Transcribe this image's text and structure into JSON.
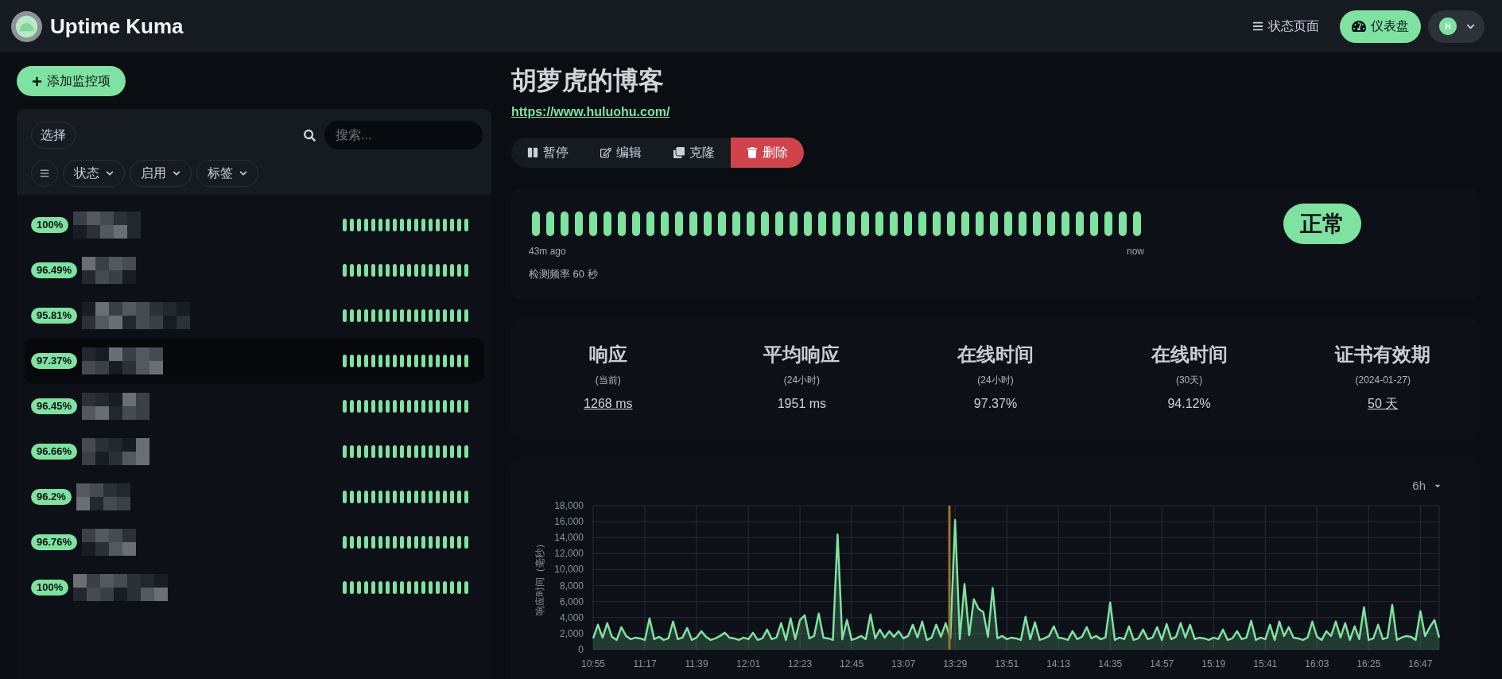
{
  "header": {
    "brand": "Uptime Kuma",
    "nav": [
      {
        "label": "状态页面",
        "kind": "link"
      },
      {
        "label": "仪表盘",
        "kind": "primary"
      }
    ],
    "profile": {
      "initial": "H"
    }
  },
  "sidebar": {
    "add_button": "添加监控项",
    "select_button": "选择",
    "search": {
      "placeholder": "搜索..."
    },
    "filters": [
      "状态",
      "启用",
      "标签"
    ],
    "monitors": [
      {
        "uptime": "100%",
        "selected": false,
        "beats": [
          {
            "up": true
          },
          {
            "up": true
          },
          {
            "up": true
          },
          {
            "up": true
          },
          {
            "up": true
          },
          {
            "up": true
          },
          {
            "up": true
          },
          {
            "up": true
          },
          {
            "up": true
          },
          {
            "up": true
          },
          {
            "up": true
          },
          {
            "up": true
          },
          {
            "up": true
          },
          {
            "up": true
          },
          {
            "up": true
          },
          {
            "up": true
          },
          {
            "up": true
          },
          {
            "up": true
          }
        ]
      },
      {
        "uptime": "96.49%",
        "selected": false,
        "beats": [
          {
            "up": true
          },
          {
            "up": true
          },
          {
            "up": true
          },
          {
            "up": true
          },
          {
            "up": true
          },
          {
            "up": true
          },
          {
            "up": true
          },
          {
            "up": true
          },
          {
            "up": true
          },
          {
            "up": true
          },
          {
            "up": true
          },
          {
            "up": true
          },
          {
            "up": true
          },
          {
            "up": true
          },
          {
            "up": true
          },
          {
            "up": true
          },
          {
            "up": true
          },
          {
            "up": true
          }
        ]
      },
      {
        "uptime": "95.81%",
        "selected": false,
        "beats": [
          {
            "up": true
          },
          {
            "up": true
          },
          {
            "up": true
          },
          {
            "up": true
          },
          {
            "up": true
          },
          {
            "up": true
          },
          {
            "up": true
          },
          {
            "up": true
          },
          {
            "up": true
          },
          {
            "up": true
          },
          {
            "up": true
          },
          {
            "up": true
          },
          {
            "up": true
          },
          {
            "up": true
          },
          {
            "up": true
          },
          {
            "up": true
          },
          {
            "up": true
          },
          {
            "up": true
          }
        ]
      },
      {
        "uptime": "97.37%",
        "selected": true,
        "beats": [
          {
            "up": true
          },
          {
            "up": true
          },
          {
            "up": true
          },
          {
            "up": true
          },
          {
            "up": true
          },
          {
            "up": true
          },
          {
            "up": true
          },
          {
            "up": true
          },
          {
            "up": true
          },
          {
            "up": true
          },
          {
            "up": true
          },
          {
            "up": true
          },
          {
            "up": true
          },
          {
            "up": true
          },
          {
            "up": true
          },
          {
            "up": true
          },
          {
            "up": true
          },
          {
            "up": true
          }
        ]
      },
      {
        "uptime": "96.45%",
        "selected": false,
        "beats": [
          {
            "up": true
          },
          {
            "up": true
          },
          {
            "up": true
          },
          {
            "up": true
          },
          {
            "up": true
          },
          {
            "up": true
          },
          {
            "up": true
          },
          {
            "up": true
          },
          {
            "up": true
          },
          {
            "up": true
          },
          {
            "up": true
          },
          {
            "up": true
          },
          {
            "up": true
          },
          {
            "up": true
          },
          {
            "up": true
          },
          {
            "up": true
          },
          {
            "up": true
          },
          {
            "up": true
          }
        ]
      },
      {
        "uptime": "96.66%",
        "selected": false,
        "beats": [
          {
            "up": true
          },
          {
            "up": true
          },
          {
            "up": true
          },
          {
            "up": true
          },
          {
            "up": true
          },
          {
            "up": true
          },
          {
            "up": true
          },
          {
            "up": true
          },
          {
            "up": true
          },
          {
            "up": true
          },
          {
            "up": true
          },
          {
            "up": true
          },
          {
            "up": true
          },
          {
            "up": true
          },
          {
            "up": true
          },
          {
            "up": true
          },
          {
            "up": true
          },
          {
            "up": true
          }
        ]
      },
      {
        "uptime": "96.2%",
        "selected": false,
        "beats": [
          {
            "up": true
          },
          {
            "up": true
          },
          {
            "up": true
          },
          {
            "up": true
          },
          {
            "up": true
          },
          {
            "up": true
          },
          {
            "up": true
          },
          {
            "up": true
          },
          {
            "up": true
          },
          {
            "up": true
          },
          {
            "up": true
          },
          {
            "up": true
          },
          {
            "up": true
          },
          {
            "up": true
          },
          {
            "up": true
          },
          {
            "up": true
          },
          {
            "up": true
          },
          {
            "up": true
          }
        ]
      },
      {
        "uptime": "96.76%",
        "selected": false,
        "beats": [
          {
            "up": true
          },
          {
            "up": true
          },
          {
            "up": true
          },
          {
            "up": true
          },
          {
            "up": true
          },
          {
            "up": true
          },
          {
            "up": true
          },
          {
            "up": true
          },
          {
            "up": true
          },
          {
            "up": true
          },
          {
            "up": true
          },
          {
            "up": true
          },
          {
            "up": true
          },
          {
            "up": true
          },
          {
            "up": true
          },
          {
            "up": true
          },
          {
            "up": true
          },
          {
            "up": true
          }
        ]
      },
      {
        "uptime": "100%",
        "selected": false,
        "beats": [
          {
            "up": true
          },
          {
            "up": true
          },
          {
            "up": true
          },
          {
            "up": true
          },
          {
            "up": true
          },
          {
            "up": true
          },
          {
            "up": true
          },
          {
            "up": true
          },
          {
            "up": true
          },
          {
            "up": true
          },
          {
            "up": true
          },
          {
            "up": true
          },
          {
            "up": true
          },
          {
            "up": true
          },
          {
            "up": true
          },
          {
            "up": true
          },
          {
            "up": true
          },
          {
            "up": true
          }
        ]
      }
    ]
  },
  "detail": {
    "title": "胡萝虎的博客",
    "url": "https://www.huluohu.com/",
    "actions": [
      {
        "label": "暂停",
        "kind": "pause"
      },
      {
        "label": "编辑",
        "kind": "edit"
      },
      {
        "label": "克隆",
        "kind": "clone"
      },
      {
        "label": "删除",
        "kind": "delete"
      }
    ],
    "heartbeat": {
      "beats": [
        {
          "up": true
        },
        {
          "up": true
        },
        {
          "up": true
        },
        {
          "up": true
        },
        {
          "up": true
        },
        {
          "up": true
        },
        {
          "up": true
        },
        {
          "up": true
        },
        {
          "up": true
        },
        {
          "up": true
        },
        {
          "up": true
        },
        {
          "up": true
        },
        {
          "up": true
        },
        {
          "up": true
        },
        {
          "up": true
        },
        {
          "up": true
        },
        {
          "up": true
        },
        {
          "up": true
        },
        {
          "up": true
        },
        {
          "up": true
        },
        {
          "up": true
        },
        {
          "up": true
        },
        {
          "up": true
        },
        {
          "up": true
        },
        {
          "up": true
        },
        {
          "up": true
        },
        {
          "up": true
        },
        {
          "up": true
        },
        {
          "up": true
        },
        {
          "up": true
        },
        {
          "up": true
        },
        {
          "up": true
        },
        {
          "up": true
        },
        {
          "up": true
        },
        {
          "up": true
        },
        {
          "up": true
        },
        {
          "up": true
        },
        {
          "up": true
        },
        {
          "up": true
        },
        {
          "up": true
        },
        {
          "up": true
        },
        {
          "up": true
        },
        {
          "up": true
        }
      ],
      "start_label": "43m ago",
      "end_label": "now",
      "interval": "检测频率 60 秒",
      "status": {
        "label": "正常",
        "kind": "up"
      }
    },
    "stats": [
      {
        "title": "响应",
        "subtitle": "(当前)",
        "value": "1268 ms",
        "link": true
      },
      {
        "title": "平均响应",
        "subtitle": "(24小时)",
        "value": "1951 ms",
        "link": false
      },
      {
        "title": "在线时间",
        "subtitle": "(24小时)",
        "value": "97.37%",
        "link": false
      },
      {
        "title": "在线时间",
        "subtitle": "(30天)",
        "value": "94.12%",
        "link": false
      },
      {
        "title": "证书有效期",
        "subtitle": "(2024-01-27)",
        "value": "50 天",
        "link": true
      }
    ],
    "chart": {
      "range": "6h",
      "chart_data": {
        "type": "area",
        "ylabel": "响应时间（毫秒）",
        "categories": [
          "10:55",
          null,
          null,
          null,
          null,
          null,
          null,
          null,
          null,
          null,
          null,
          "11:17",
          null,
          null,
          null,
          null,
          null,
          null,
          null,
          null,
          null,
          null,
          "11:39",
          null,
          null,
          null,
          null,
          null,
          null,
          null,
          null,
          null,
          null,
          "12:01",
          null,
          null,
          null,
          null,
          null,
          null,
          null,
          null,
          null,
          null,
          "12:23",
          null,
          null,
          null,
          null,
          null,
          null,
          null,
          null,
          null,
          null,
          "12:45",
          null,
          null,
          null,
          null,
          null,
          null,
          null,
          null,
          null,
          null,
          "13:07",
          null,
          null,
          null,
          null,
          null,
          null,
          null,
          null,
          null,
          null,
          "13:29",
          null,
          null,
          null,
          null,
          null,
          null,
          null,
          null,
          null,
          null,
          "13:51",
          null,
          null,
          null,
          null,
          null,
          null,
          null,
          null,
          null,
          null,
          "14:13",
          null,
          null,
          null,
          null,
          null,
          null,
          null,
          null,
          null,
          null,
          "14:35",
          null,
          null,
          null,
          null,
          null,
          null,
          null,
          null,
          null,
          null,
          "14:57",
          null,
          null,
          null,
          null,
          null,
          null,
          null,
          null,
          null,
          null,
          "15:19",
          null,
          null,
          null,
          null,
          null,
          null,
          null,
          null,
          null,
          null,
          "15:41",
          null,
          null,
          null,
          null,
          null,
          null,
          null,
          null,
          null,
          null,
          "16:03",
          null,
          null,
          null,
          null,
          null,
          null,
          null,
          null,
          null,
          null,
          "16:25",
          null,
          null,
          null,
          null,
          null,
          null,
          null,
          null,
          null,
          null,
          "16:47",
          null,
          null,
          null,
          null
        ],
        "series": [
          {
            "color": "#7ee2a0",
            "values": [
              1400,
              3100,
              1500,
              3300,
              1600,
              1200,
              2800,
              1700,
              1300,
              1500,
              1400,
              1200,
              3900,
              1300,
              1600,
              1200,
              1400,
              3500,
              1300,
              1500,
              2700,
              1200,
              1500,
              2300,
              1600,
              1200,
              1400,
              1700,
              2100,
              1500,
              1400,
              1200,
              1500,
              1300,
              2100,
              1200,
              1400,
              2500,
              1300,
              1500,
              3300,
              1200,
              3900,
              1300,
              3700,
              4300,
              1400,
              1700,
              4500,
              1500,
              1400,
              1200,
              14400,
              1300,
              3700,
              1200,
              1400,
              1700,
              1300,
              4400,
              1400,
              2500,
              1500,
              2300,
              1600,
              2300,
              1400,
              1700,
              3100,
              1500,
              3500,
              1200,
              1500,
              3100,
              1600,
              3300,
              1400,
              16200,
              1300,
              8200,
              1800,
              6300,
              5100,
              4700,
              1600,
              7700,
              1400,
              1700,
              1300,
              1500,
              1400,
              1200,
              4100,
              1300,
              3400,
              1200,
              1400,
              1700,
              2900,
              1500,
              1400,
              1200,
              2300,
              1300,
              1600,
              2800,
              1400,
              1700,
              1300,
              1500,
              5900,
              1200,
              1500,
              1300,
              2900,
              1200,
              1400,
              2500,
              1300,
              1500,
              2800,
              1200,
              3200,
              1300,
              1600,
              3300,
              1500,
              3100,
              1300,
              1500,
              1400,
              1200,
              1500,
              1300,
              2500,
              1200,
              1400,
              2300,
              1300,
              1500,
              3600,
              1200,
              1500,
              1300,
              3100,
              1200,
              3500,
              1700,
              2800,
              1500,
              1400,
              1200,
              1500,
              3500,
              1600,
              1200,
              2300,
              1700,
              3500,
              1500,
              3300,
              1200,
              2900,
              1300,
              5300,
              1200,
              1400,
              3100,
              1300,
              1500,
              5600,
              1200,
              1500,
              1700,
              1600,
              1200,
              4800,
              1700,
              2800,
              3700,
              1500
            ]
          }
        ],
        "ylim": [
          0,
          18000
        ],
        "yticks": [
          0,
          {
            "value": 2000,
            "label": "2,000"
          },
          {
            "value": 4000,
            "label": "4,000"
          },
          {
            "value": 6000,
            "label": "6,000"
          },
          {
            "value": 8000,
            "label": "8,000"
          },
          {
            "value": 10000,
            "label": "10,000"
          },
          {
            "value": 12000,
            "label": "12,000"
          },
          {
            "value": 14000,
            "label": "14,000"
          },
          {
            "value": 16000,
            "label": "16,000"
          },
          {
            "value": 18000,
            "label": "18,000"
          }
        ],
        "grid": true
      }
    }
  }
}
